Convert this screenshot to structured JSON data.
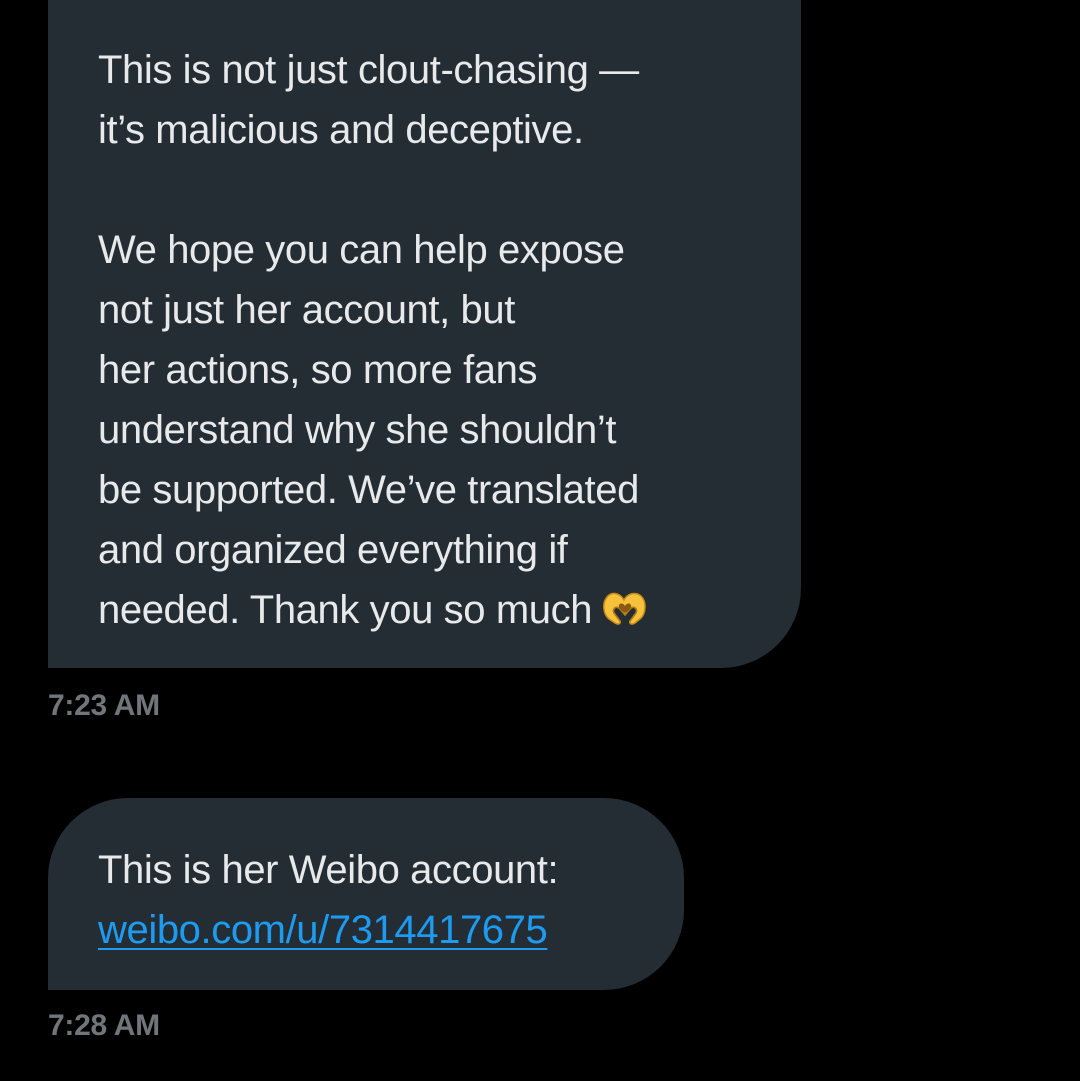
{
  "messages": [
    {
      "paragraphs": [
        [
          "This is not just clout-chasing —",
          "it’s malicious and deceptive."
        ],
        [
          "We hope you can help expose",
          "not just her account, but",
          "her actions, so more fans",
          "understand why she shouldn’t",
          "be supported. We’ve translated",
          "and organized everything if",
          "needed. Thank you so much"
        ]
      ],
      "emoji": "heart-hands-emoji",
      "timestamp": "7:23 AM"
    },
    {
      "text": "This is her Weibo account:",
      "link": "weibo.com/u/7314417675",
      "timestamp": "7:28 AM"
    }
  ],
  "colors": {
    "background": "#000000",
    "bubble": "#252d34",
    "text": "#e7e9ea",
    "link": "#1d9bf0",
    "timestamp": "#71767b",
    "emoji": "#f7c23b"
  }
}
